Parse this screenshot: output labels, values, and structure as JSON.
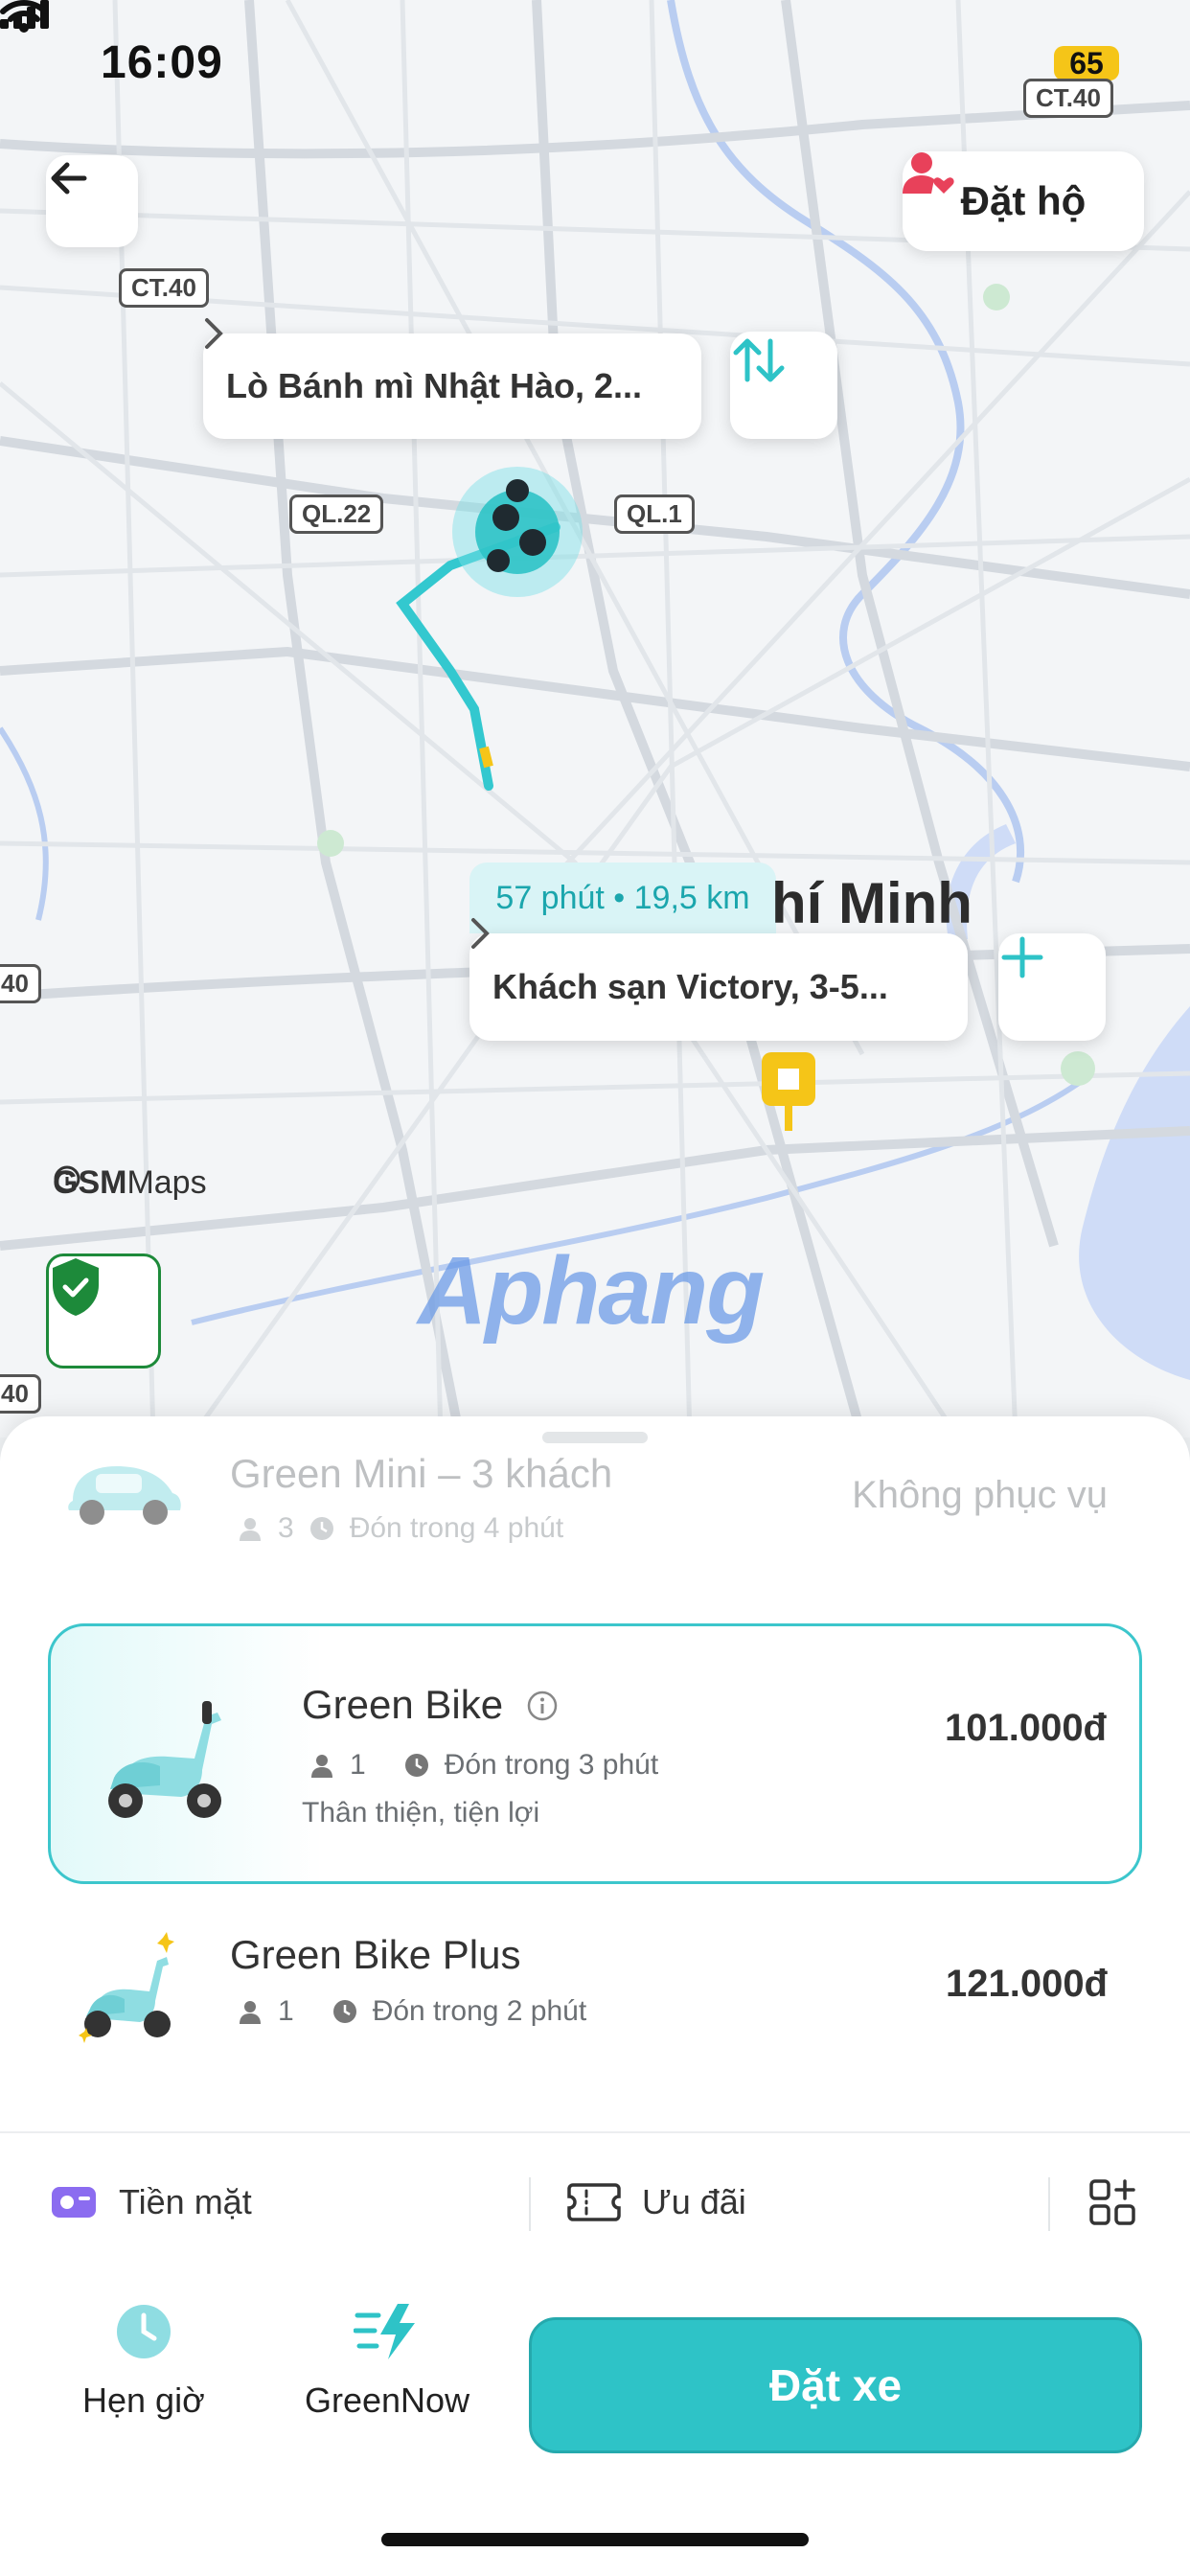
{
  "status_bar": {
    "time": "16:09",
    "battery": "65"
  },
  "map": {
    "road_labels": [
      "CT.40",
      "CT.40",
      "QL.22",
      "QL.1",
      "40",
      "40"
    ],
    "pickup": "Lò Bánh mì Nhật Hào, 2...",
    "dropoff": "Khách sạn Victory, 3-5...",
    "eta": "57 phút • 19,5 km",
    "city_label": "hí Minh",
    "attribution_bold": "GSM",
    "attribution_light": "Maps",
    "watermark": "Aphang"
  },
  "header": {
    "book_for_label": "Đặt hộ"
  },
  "rides": [
    {
      "name": "Green Mini – 3 khách",
      "seats": "3",
      "pickup_time": "Đón trong 4 phút",
      "price": "Không phục vụ",
      "available": false
    },
    {
      "name": "Green Bike",
      "seats": "1",
      "pickup_time": "Đón trong 3 phút",
      "subtitle": "Thân thiện, tiện lợi",
      "price": "101.000đ",
      "selected": true
    },
    {
      "name": "Green Bike Plus",
      "seats": "1",
      "pickup_time": "Đón trong 2 phút",
      "price": "121.000đ"
    }
  ],
  "payment": {
    "method": "Tiền mặt",
    "promo": "Ưu đãi"
  },
  "actions": {
    "schedule": "Hẹn giờ",
    "green_now": "GreenNow",
    "book": "Đặt xe"
  },
  "colors": {
    "accent": "#2ec3c7",
    "shield_green": "#1d8a3a",
    "pin": "#f5c518"
  }
}
